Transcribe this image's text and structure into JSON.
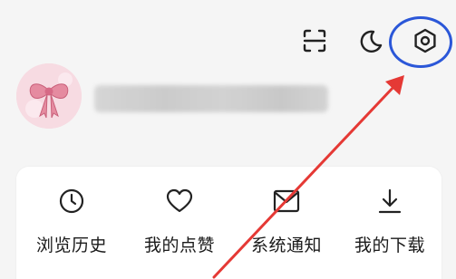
{
  "topbar": {
    "icons": [
      "scan-icon",
      "moon-icon",
      "settings-icon"
    ]
  },
  "profile": {
    "avatar": "bow-avatar"
  },
  "quick_actions": [
    {
      "label": "浏览历史",
      "icon": "clock-icon"
    },
    {
      "label": "我的点赞",
      "icon": "heart-icon"
    },
    {
      "label": "系统通知",
      "icon": "message-icon"
    },
    {
      "label": "我的下载",
      "icon": "download-icon"
    }
  ],
  "annotation": {
    "color": "#2b57d8",
    "arrow_color": "#e53935"
  }
}
